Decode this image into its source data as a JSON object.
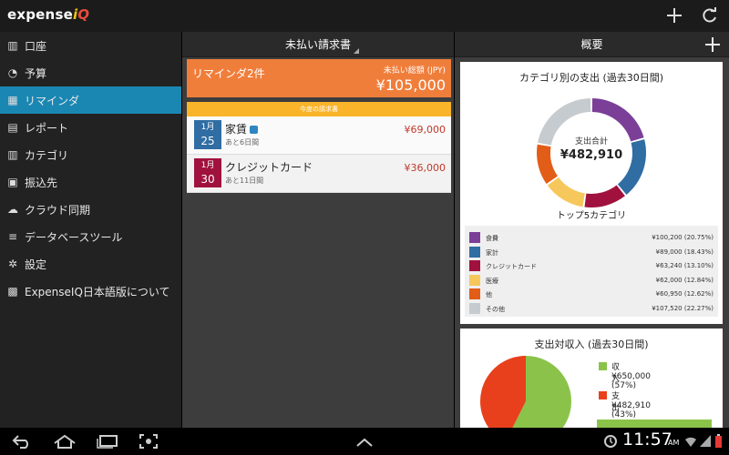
{
  "app": {
    "logo_main": "expense",
    "logo_i": "i",
    "logo_q": "Q"
  },
  "sidebar": {
    "items": [
      {
        "label": "口座",
        "icon": "accounts-icon"
      },
      {
        "label": "予算",
        "icon": "budget-icon"
      },
      {
        "label": "リマインダ",
        "icon": "calendar-icon"
      },
      {
        "label": "レポート",
        "icon": "report-icon"
      },
      {
        "label": "カテゴリ",
        "icon": "category-icon"
      },
      {
        "label": "振込先",
        "icon": "payee-icon"
      },
      {
        "label": "クラウド同期",
        "icon": "cloud-icon"
      },
      {
        "label": "データベースツール",
        "icon": "database-icon"
      },
      {
        "label": "設定",
        "icon": "settings-icon"
      },
      {
        "label": "ExpenseIQ日本語版について",
        "icon": "app-icon"
      }
    ],
    "active_index": 2
  },
  "bills": {
    "title": "未払い請求書",
    "banner": {
      "count_label": "リマインダ2件",
      "total_label": "未払い総額 (JPY)",
      "total_amount": "¥105,000"
    },
    "section_label": "今度の請求書",
    "items": [
      {
        "month": "1月",
        "day": "25",
        "name": "家賃",
        "due": "あと6日間",
        "amount": "¥69,000",
        "color": "#2f6da3",
        "synced": true
      },
      {
        "month": "1月",
        "day": "30",
        "name": "クレジットカード",
        "due": "あと11日間",
        "amount": "¥36,000",
        "color": "#a0123d",
        "synced": false
      }
    ]
  },
  "overview": {
    "title": "概要",
    "spending_card": {
      "title": "カテゴリ別の支出 (過去30日間)",
      "center_label": "支出合計",
      "center_value": "¥482,910",
      "top5_label": "トップ5カテゴリ",
      "categories": [
        {
          "name": "食費",
          "value": "¥100,200",
          "pct": "(20.75%)",
          "color": "#7b3f98"
        },
        {
          "name": "家計",
          "value": "¥89,000",
          "pct": "(18.43%)",
          "color": "#2f6da3"
        },
        {
          "name": "クレジットカード",
          "value": "¥63,240",
          "pct": "(13.10%)",
          "color": "#a0123d"
        },
        {
          "name": "医療",
          "value": "¥62,000",
          "pct": "(12.84%)",
          "color": "#f6c75b"
        },
        {
          "name": "他",
          "value": "¥60,950",
          "pct": "(12.62%)",
          "color": "#e25d17"
        },
        {
          "name": "その他",
          "value": "¥107,520",
          "pct": "(22.27%)",
          "color": "#c6cbcf"
        }
      ]
    },
    "income_card": {
      "title": "支出対収入 (過去30日間)",
      "items": [
        {
          "name": "収入",
          "value": "¥650,000 (57%)",
          "color": "#8bc34a"
        },
        {
          "name": "支出",
          "value": "¥482,910 (43%)",
          "color": "#e8401c"
        }
      ]
    }
  },
  "chart_data": [
    {
      "type": "pie",
      "title": "カテゴリ別の支出 (過去30日間)",
      "categories": [
        "食費",
        "家計",
        "クレジットカード",
        "医療",
        "他",
        "その他"
      ],
      "values": [
        100200,
        89000,
        63240,
        62000,
        60950,
        107520
      ],
      "percentages": [
        20.75,
        18.43,
        13.1,
        12.84,
        12.62,
        22.27
      ],
      "colors": [
        "#7b3f98",
        "#2f6da3",
        "#a0123d",
        "#f6c75b",
        "#e25d17",
        "#c6cbcf"
      ],
      "donut": true,
      "center_text": "支出合計 ¥482,910"
    },
    {
      "type": "pie",
      "title": "支出対収入 (過去30日間)",
      "categories": [
        "収入",
        "支出"
      ],
      "values": [
        650000,
        482910
      ],
      "percentages": [
        57,
        43
      ],
      "colors": [
        "#8bc34a",
        "#e8401c"
      ]
    }
  ],
  "statusbar": {
    "time": "11:57",
    "ampm": "AM"
  }
}
